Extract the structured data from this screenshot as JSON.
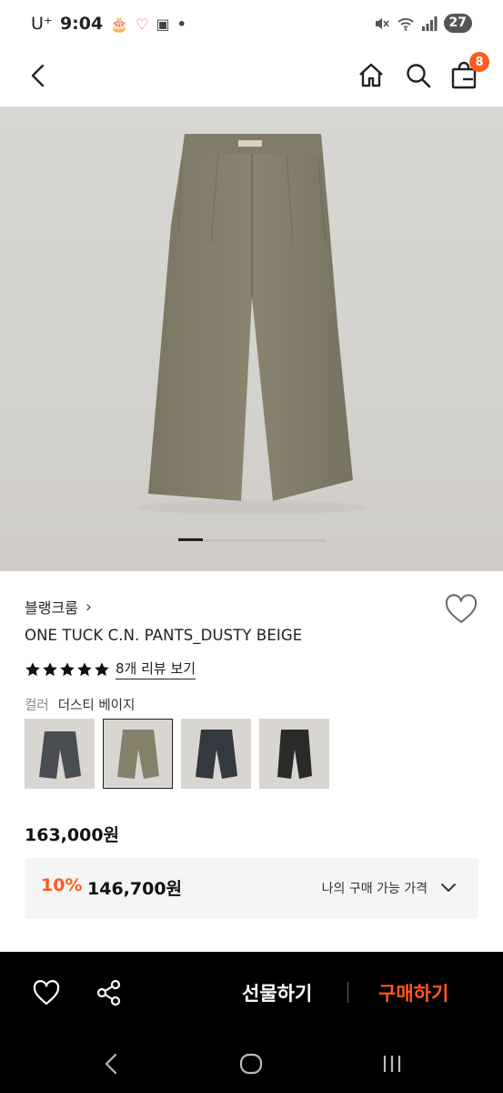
{
  "status_bar": {
    "carrier": "U⁺",
    "time": "9:04",
    "battery": "27"
  },
  "nav": {
    "cart_count": "8"
  },
  "product": {
    "brand": "블랭크룸",
    "brand_chevron": "›",
    "title": "ONE TUCK C.N. PANTS_DUSTY BEIGE",
    "rating": 5,
    "review_link": "8개 리뷰 보기",
    "color_label": "컬러",
    "color_value": "더스티 베이지",
    "swatches": [
      {
        "name": "charcoal-stripe",
        "color": "#4a4d52"
      },
      {
        "name": "dusty-beige",
        "color": "#85806a"
      },
      {
        "name": "navy",
        "color": "#34383f"
      },
      {
        "name": "black",
        "color": "#2a2a2a"
      }
    ],
    "selected_swatch": 1,
    "original_price": "163,000원",
    "discount_rate": "10%",
    "sale_price": "146,700원",
    "my_price_label": "나의 구매 가능 가격"
  },
  "bottom_bar": {
    "gift_label": "선물하기",
    "buy_label": "구매하기"
  },
  "colors": {
    "accent": "#ff5a1f",
    "pants": "#85806a"
  }
}
